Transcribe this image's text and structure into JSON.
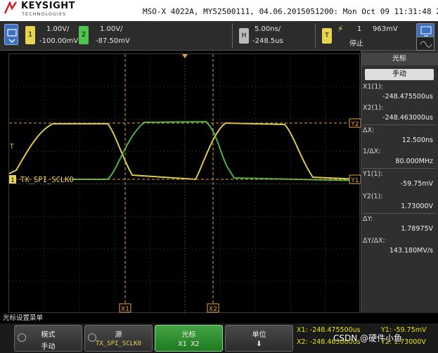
{
  "header": {
    "brand": "KEYSIGHT",
    "brand_sub": "TECHNOLOGIES",
    "info": "MSO-X 4022A, MY52500111, 04.06.2015051200: Mon Oct 09 11:31:48 2023"
  },
  "settings": {
    "ch1": {
      "label": "1",
      "scale": "1.00V/",
      "offset": "-100.00mV",
      "color": "#e7d451"
    },
    "ch2": {
      "label": "2",
      "scale": "1.00V/",
      "offset": "-87.50mV",
      "color": "#4fc34f"
    },
    "horizontal": {
      "label": "H",
      "timebase": "5.00ns/",
      "delay": "-248.5us"
    },
    "trigger": {
      "label": "T",
      "edge_symbol": "⚡",
      "source": "1",
      "level": "963mV",
      "status": "停止"
    }
  },
  "screen": {
    "channel_label": "TX_SPI_SCLK0",
    "marker_labels": {
      "x1": "X1",
      "x2": "X2",
      "y1": "Y1",
      "y2": "Y2",
      "ch_marker": "1",
      "trig_marker": "T"
    }
  },
  "side_panel": {
    "title": "光标",
    "mode": "手动",
    "rows": [
      {
        "label": "X1(1):",
        "value": "-248.475500us"
      },
      {
        "label": "X2(1):",
        "value": "-248.463000us"
      },
      {
        "label": "ΔX:",
        "value": "12.500ns"
      },
      {
        "label": "1/ΔX:",
        "value": "80.000MHz"
      },
      {
        "label": "Y1(1):",
        "value": "-59.75mV"
      },
      {
        "label": "Y2(1):",
        "value": "1.73000V"
      },
      {
        "label": "ΔY:",
        "value": "1.78975V"
      },
      {
        "label": "ΔY/ΔX:",
        "value": "143.180MV/s"
      }
    ]
  },
  "softkeys": {
    "title": "光标设置菜单",
    "keys": [
      {
        "l1": "模式",
        "l2": "手动"
      },
      {
        "l1": "源",
        "l2": "TX_SPI_SCLK0"
      },
      {
        "l1": "光标",
        "l2": "X1 X2"
      },
      {
        "l1": "单位",
        "l2": "⬇"
      }
    ],
    "info": {
      "x1": "X1: -248.475500us",
      "x2": "X2: -248.463000us",
      "y1": "Y1: -59.75mV",
      "y2": "Y2: 1.73000V"
    }
  },
  "watermark": "CSDN @硬件小鱼",
  "colors": {
    "ch1": "#e7d451",
    "ch2": "#4fc34f",
    "cursor": "#e3a43b",
    "grid": "#3a3a3a"
  }
}
